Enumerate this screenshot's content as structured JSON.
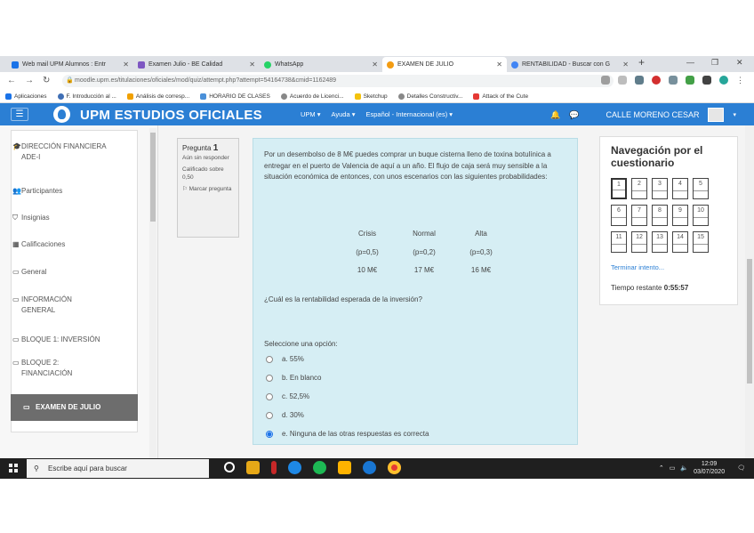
{
  "browser": {
    "tabs": [
      {
        "title": "Web mail UPM Alumnos : Entr",
        "color": "#1a73e8"
      },
      {
        "title": "Examen Julio - BE Calidad",
        "color": "#7e57c2"
      },
      {
        "title": "WhatsApp",
        "color": "#25d366"
      },
      {
        "title": "EXAMEN DE JULIO",
        "color": "#f39c12"
      },
      {
        "title": "RENTABILIDAD - Buscar con G",
        "color": "#4285f4"
      }
    ],
    "new_tab": "+",
    "url": "moodle.upm.es/titulaciones/oficiales/mod/quiz/attempt.php?attempt=54164738&cmid=1162489"
  },
  "bookmarks": [
    {
      "label": "Aplicaciones",
      "color": "#1a73e8"
    },
    {
      "label": "F. Introducción al ...",
      "color": "#3f6fb5"
    },
    {
      "label": "Análisis de corresp...",
      "color": "#f0a000"
    },
    {
      "label": "HORARIO DE CLASES",
      "color": "#4a90d9"
    },
    {
      "label": "Acuerdo de Licenci...",
      "color": "#888888"
    },
    {
      "label": "Sketchup",
      "color": "#f4c20d"
    },
    {
      "label": "Detalles Constructiv...",
      "color": "#888888"
    },
    {
      "label": "Attack of the Cute",
      "color": "#e53935"
    }
  ],
  "moodle": {
    "site_name": "UPM ESTUDIOS OFICIALES",
    "menu": [
      "UPM ▾",
      "Ayuda ▾",
      "Español - Internacional (es) ▾"
    ],
    "user": "CALLE MORENO CESAR",
    "brand_color": "#2b7fd4"
  },
  "sidebar": {
    "items": [
      {
        "label": "DIRECCIÓN FINANCIERA ADE-I",
        "icon": "graduation-cap-icon",
        "glyph": "🎓"
      },
      {
        "label": "Participantes",
        "icon": "users-icon",
        "glyph": "👥"
      },
      {
        "label": "Insignias",
        "icon": "badge-icon",
        "glyph": "⛉"
      },
      {
        "label": "Calificaciones",
        "icon": "table-icon",
        "glyph": "▦"
      },
      {
        "label": "General",
        "icon": "folder-icon",
        "glyph": "▭"
      },
      {
        "label": "INFORMACIÓN GENERAL",
        "icon": "folder-icon",
        "glyph": "▭"
      },
      {
        "label": "BLOQUE 1: INVERSIÓN",
        "icon": "folder-icon",
        "glyph": "▭"
      },
      {
        "label": "BLOQUE 2: FINANCIACIÓN",
        "icon": "folder-icon",
        "glyph": "▭"
      },
      {
        "label": "EXAMEN DE JULIO",
        "icon": "folder-icon",
        "glyph": "▭"
      }
    ]
  },
  "question": {
    "label": "Pregunta",
    "number": "1",
    "status": "Aún sin responder",
    "score": "Calificado sobre 0,50",
    "flag": "Marcar pregunta",
    "text": "Por un desembolso de 8 M€ puedes comprar un buque cisterna lleno de toxina botulínica a entregar en el puerto de Valencia de aquí a un año. El flujo de caja será muy sensible a la situación económica de entonces, con unos escenarios con las siguientes probabilidades:",
    "table": {
      "headers": [
        "Crisis",
        "Normal",
        "Alta"
      ],
      "probs": [
        "(p=0,5)",
        "(p=0,2)",
        "(p=0,3)"
      ],
      "values": [
        "10 M€",
        "17 M€",
        "16 M€"
      ]
    },
    "prompt": "¿Cuál es la rentabilidad esperada de la inversión?",
    "select_label": "Seleccione una opción:",
    "options": [
      {
        "label": "a. 55%",
        "selected": false
      },
      {
        "label": "b. En blanco",
        "selected": false
      },
      {
        "label": "c. 52,5%",
        "selected": false
      },
      {
        "label": "d. 30%",
        "selected": false
      },
      {
        "label": "e. Ninguna de las otras respuestas es correcta",
        "selected": true
      }
    ]
  },
  "quiz_nav": {
    "title": "Navegación por el cuestionario",
    "questions": [
      "1",
      "2",
      "3",
      "4",
      "5",
      "6",
      "7",
      "8",
      "9",
      "10",
      "11",
      "12",
      "13",
      "14",
      "15"
    ],
    "current": "1",
    "finish": "Terminar intento...",
    "time_label": "Tiempo restante",
    "time_value": "0:55:57"
  },
  "taskbar": {
    "search_placeholder": "Escribe aquí para buscar",
    "apps": [
      "#ffffff",
      "#e6a817",
      "#c62828",
      "#1e88e5",
      "#1db954",
      "#ffb300",
      "#1976d2",
      "#e53935"
    ],
    "time": "12:09",
    "date": "03/07/2020"
  }
}
